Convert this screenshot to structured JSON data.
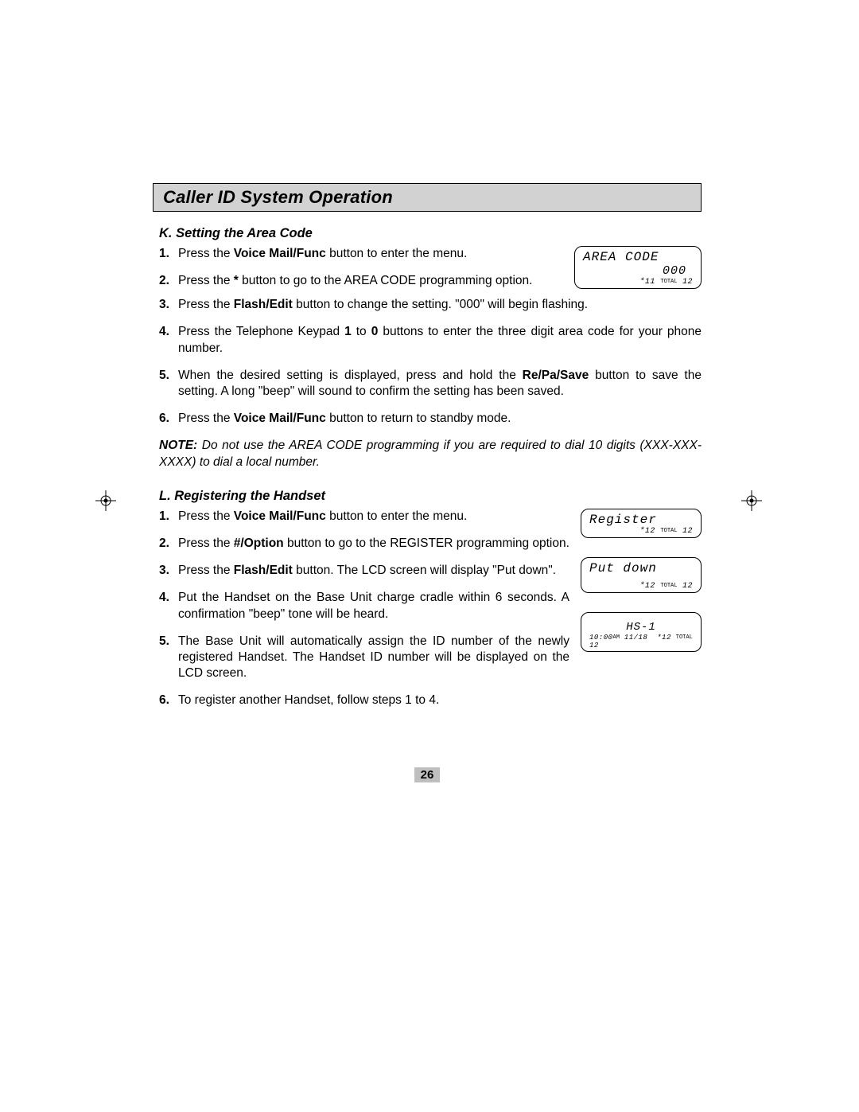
{
  "title": "Caller ID System Operation",
  "sectionK": {
    "heading": "K.  Setting the Area Code",
    "lcd": {
      "line1": "AREA CODE",
      "line2": "000",
      "line3_prefix": "*11",
      "line3_small": "TOTAL",
      "line3_suffix": "12"
    },
    "steps": {
      "s1a": "Press the ",
      "s1b": "Voice Mail/Func",
      "s1c": " button to enter the menu.",
      "s2a": "Press the   ",
      "s2b": "*",
      "s2c": "   button to go to the AREA CODE programming option.",
      "s3a": "Press the   ",
      "s3b": "Flash/Edit",
      "s3c": "   button to change the setting. \"000\" will begin flashing.",
      "s4a": "Press the Telephone Keypad ",
      "s4b": "1",
      "s4c": " to ",
      "s4d": "0",
      "s4e": " buttons to enter the three digit area code for your phone number.",
      "s5a": "When the desired setting is displayed, press and hold the  ",
      "s5b": "Re/Pa/Save",
      "s5c": " button to save the setting. A long \"beep\" will sound to confirm the setting has been saved.",
      "s6a": "Press the  ",
      "s6b": "Voice Mail/Func",
      "s6c": "  button to return to ",
      "s6d": "standby",
      "s6e": " mode."
    },
    "note_lead": "NOTE:",
    "note_body": "  Do not use the AREA CODE programming if you are required to dial 10 digits (XXX-XXX-XXXX) to dial a local number."
  },
  "sectionL": {
    "heading": "L.  Registering the Handset",
    "lcd1": {
      "line1": "Register",
      "line3_prefix": "*12",
      "line3_small": "TOTAL",
      "line3_suffix": "12"
    },
    "lcd2": {
      "line1": "Put down",
      "line3_prefix": "*12",
      "line3_small": "TOTAL",
      "line3_suffix": "12"
    },
    "lcd3": {
      "line1": "HS-1",
      "line3_left": "10:00",
      "line3_ampm": "AM",
      "line3_date": "11/18",
      "line3_prefix": "*12",
      "line3_small": "TOTAL",
      "line3_suffix": "12"
    },
    "steps": {
      "s1a": "Press the ",
      "s1b": "Voice Mail/Func",
      "s1c": " button to enter the menu.",
      "s2a": "Press the ",
      "s2b": "#/Option",
      "s2c": " button to go to the REGISTER programming option.",
      "s3a": "Press the ",
      "s3b": "Flash/Edit",
      "s3c": " button. The LCD screen will display \"Put down\".",
      "s4": "Put the Handset on the Base Unit charge cradle within 6 seconds. A confirmation \"beep\" tone will be heard.",
      "s5": "The Base Unit will automatically assign the ID number of the newly registered Handset. The Handset ID number will be displayed on the LCD screen.",
      "s6": "To register another Handset, follow steps 1 to 4."
    }
  },
  "page_number": "26"
}
